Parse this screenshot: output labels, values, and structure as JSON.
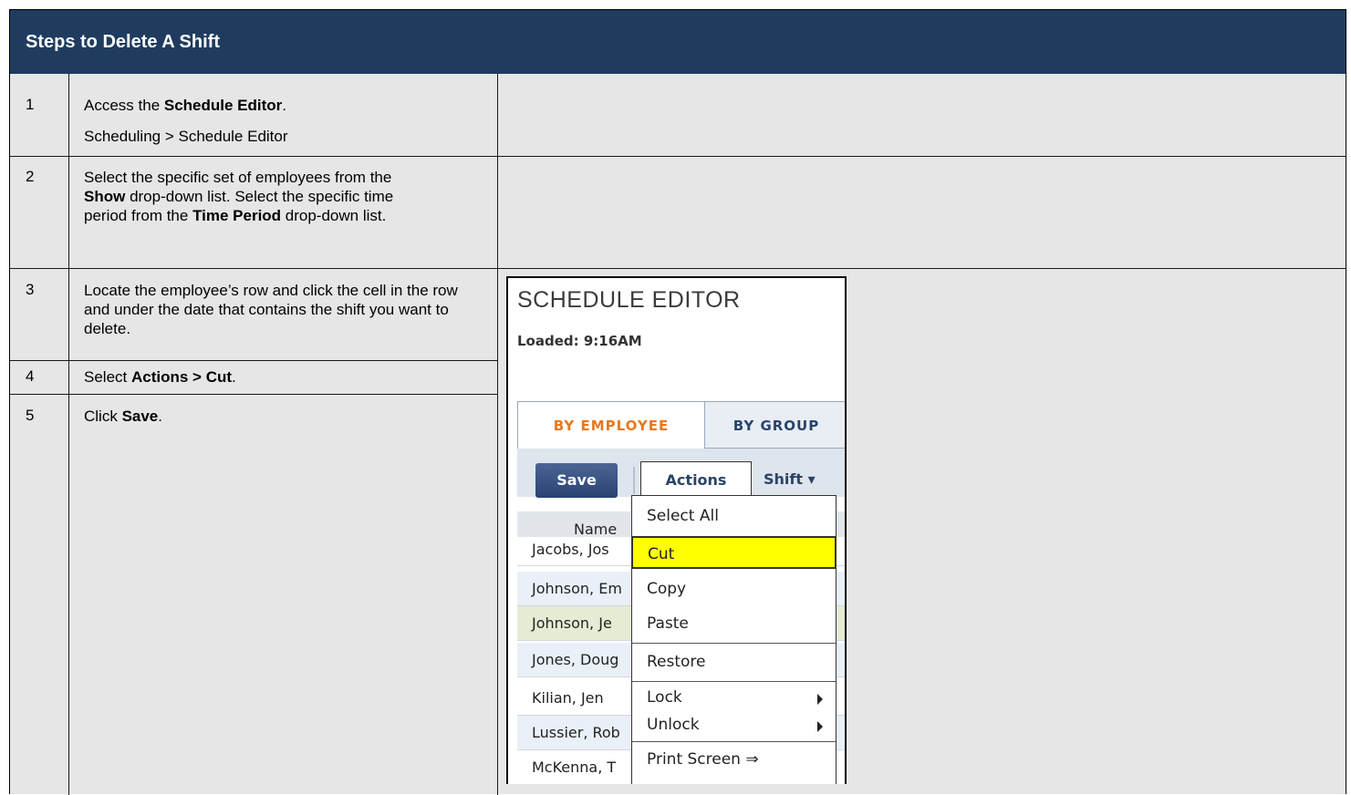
{
  "header": {
    "title": "Steps to Delete A Shift"
  },
  "steps": [
    {
      "num": "1",
      "line1_pre": "Access the ",
      "line1_bold": "Schedule Editor",
      "line1_post": ".",
      "line2": "Scheduling > Schedule Editor"
    },
    {
      "num": "2",
      "a": "Select the specific set of employees from the ",
      "b1": "Show",
      "c": " drop-down list. Select the specific time period from the ",
      "b2": "Time Period",
      "d": " drop-down list."
    },
    {
      "num": "3",
      "text": "Locate the employee’s row and click the cell in the row and under the date that contains the shift you want to delete."
    },
    {
      "num": "4",
      "pre": "Select ",
      "bold": "Actions > Cut",
      "post": "."
    },
    {
      "num": "5",
      "pre": "Click ",
      "bold": "Save",
      "post": "."
    }
  ],
  "screenshot": {
    "title": "SCHEDULE EDITOR",
    "loaded": "Loaded: 9:16AM",
    "tabs": [
      "BY EMPLOYEE",
      "BY GROUP"
    ],
    "save_label": "Save",
    "actions_label": "Actions",
    "shift_label": "Shift ▾",
    "grid_header": "Name",
    "rows": [
      "Jacobs, Jos",
      "Johnson, Em",
      "Johnson, Je",
      "Jones, Doug",
      "Kilian, Jen",
      "Lussier, Rob",
      "McKenna, T"
    ],
    "menu": [
      "Select All",
      "Cut",
      "Copy",
      "Paste",
      "Restore",
      "Lock",
      "Unlock",
      "Print Screen ⇒"
    ]
  }
}
